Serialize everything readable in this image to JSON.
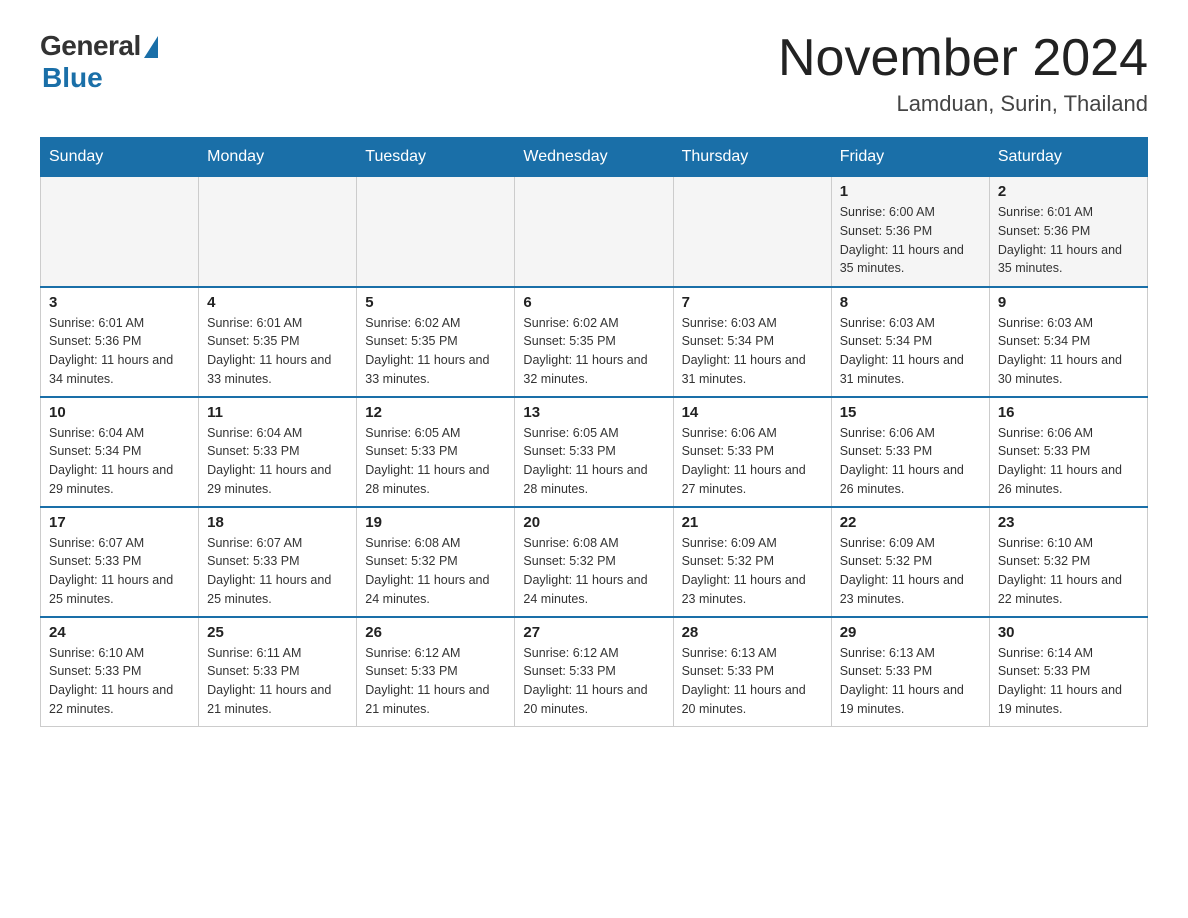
{
  "header": {
    "logo_general": "General",
    "logo_blue": "Blue",
    "month_title": "November 2024",
    "location": "Lamduan, Surin, Thailand"
  },
  "calendar": {
    "days_of_week": [
      "Sunday",
      "Monday",
      "Tuesday",
      "Wednesday",
      "Thursday",
      "Friday",
      "Saturday"
    ],
    "weeks": [
      [
        {
          "day": "",
          "sunrise": "",
          "sunset": "",
          "daylight": ""
        },
        {
          "day": "",
          "sunrise": "",
          "sunset": "",
          "daylight": ""
        },
        {
          "day": "",
          "sunrise": "",
          "sunset": "",
          "daylight": ""
        },
        {
          "day": "",
          "sunrise": "",
          "sunset": "",
          "daylight": ""
        },
        {
          "day": "",
          "sunrise": "",
          "sunset": "",
          "daylight": ""
        },
        {
          "day": "1",
          "sunrise": "Sunrise: 6:00 AM",
          "sunset": "Sunset: 5:36 PM",
          "daylight": "Daylight: 11 hours and 35 minutes."
        },
        {
          "day": "2",
          "sunrise": "Sunrise: 6:01 AM",
          "sunset": "Sunset: 5:36 PM",
          "daylight": "Daylight: 11 hours and 35 minutes."
        }
      ],
      [
        {
          "day": "3",
          "sunrise": "Sunrise: 6:01 AM",
          "sunset": "Sunset: 5:36 PM",
          "daylight": "Daylight: 11 hours and 34 minutes."
        },
        {
          "day": "4",
          "sunrise": "Sunrise: 6:01 AM",
          "sunset": "Sunset: 5:35 PM",
          "daylight": "Daylight: 11 hours and 33 minutes."
        },
        {
          "day": "5",
          "sunrise": "Sunrise: 6:02 AM",
          "sunset": "Sunset: 5:35 PM",
          "daylight": "Daylight: 11 hours and 33 minutes."
        },
        {
          "day": "6",
          "sunrise": "Sunrise: 6:02 AM",
          "sunset": "Sunset: 5:35 PM",
          "daylight": "Daylight: 11 hours and 32 minutes."
        },
        {
          "day": "7",
          "sunrise": "Sunrise: 6:03 AM",
          "sunset": "Sunset: 5:34 PM",
          "daylight": "Daylight: 11 hours and 31 minutes."
        },
        {
          "day": "8",
          "sunrise": "Sunrise: 6:03 AM",
          "sunset": "Sunset: 5:34 PM",
          "daylight": "Daylight: 11 hours and 31 minutes."
        },
        {
          "day": "9",
          "sunrise": "Sunrise: 6:03 AM",
          "sunset": "Sunset: 5:34 PM",
          "daylight": "Daylight: 11 hours and 30 minutes."
        }
      ],
      [
        {
          "day": "10",
          "sunrise": "Sunrise: 6:04 AM",
          "sunset": "Sunset: 5:34 PM",
          "daylight": "Daylight: 11 hours and 29 minutes."
        },
        {
          "day": "11",
          "sunrise": "Sunrise: 6:04 AM",
          "sunset": "Sunset: 5:33 PM",
          "daylight": "Daylight: 11 hours and 29 minutes."
        },
        {
          "day": "12",
          "sunrise": "Sunrise: 6:05 AM",
          "sunset": "Sunset: 5:33 PM",
          "daylight": "Daylight: 11 hours and 28 minutes."
        },
        {
          "day": "13",
          "sunrise": "Sunrise: 6:05 AM",
          "sunset": "Sunset: 5:33 PM",
          "daylight": "Daylight: 11 hours and 28 minutes."
        },
        {
          "day": "14",
          "sunrise": "Sunrise: 6:06 AM",
          "sunset": "Sunset: 5:33 PM",
          "daylight": "Daylight: 11 hours and 27 minutes."
        },
        {
          "day": "15",
          "sunrise": "Sunrise: 6:06 AM",
          "sunset": "Sunset: 5:33 PM",
          "daylight": "Daylight: 11 hours and 26 minutes."
        },
        {
          "day": "16",
          "sunrise": "Sunrise: 6:06 AM",
          "sunset": "Sunset: 5:33 PM",
          "daylight": "Daylight: 11 hours and 26 minutes."
        }
      ],
      [
        {
          "day": "17",
          "sunrise": "Sunrise: 6:07 AM",
          "sunset": "Sunset: 5:33 PM",
          "daylight": "Daylight: 11 hours and 25 minutes."
        },
        {
          "day": "18",
          "sunrise": "Sunrise: 6:07 AM",
          "sunset": "Sunset: 5:33 PM",
          "daylight": "Daylight: 11 hours and 25 minutes."
        },
        {
          "day": "19",
          "sunrise": "Sunrise: 6:08 AM",
          "sunset": "Sunset: 5:32 PM",
          "daylight": "Daylight: 11 hours and 24 minutes."
        },
        {
          "day": "20",
          "sunrise": "Sunrise: 6:08 AM",
          "sunset": "Sunset: 5:32 PM",
          "daylight": "Daylight: 11 hours and 24 minutes."
        },
        {
          "day": "21",
          "sunrise": "Sunrise: 6:09 AM",
          "sunset": "Sunset: 5:32 PM",
          "daylight": "Daylight: 11 hours and 23 minutes."
        },
        {
          "day": "22",
          "sunrise": "Sunrise: 6:09 AM",
          "sunset": "Sunset: 5:32 PM",
          "daylight": "Daylight: 11 hours and 23 minutes."
        },
        {
          "day": "23",
          "sunrise": "Sunrise: 6:10 AM",
          "sunset": "Sunset: 5:32 PM",
          "daylight": "Daylight: 11 hours and 22 minutes."
        }
      ],
      [
        {
          "day": "24",
          "sunrise": "Sunrise: 6:10 AM",
          "sunset": "Sunset: 5:33 PM",
          "daylight": "Daylight: 11 hours and 22 minutes."
        },
        {
          "day": "25",
          "sunrise": "Sunrise: 6:11 AM",
          "sunset": "Sunset: 5:33 PM",
          "daylight": "Daylight: 11 hours and 21 minutes."
        },
        {
          "day": "26",
          "sunrise": "Sunrise: 6:12 AM",
          "sunset": "Sunset: 5:33 PM",
          "daylight": "Daylight: 11 hours and 21 minutes."
        },
        {
          "day": "27",
          "sunrise": "Sunrise: 6:12 AM",
          "sunset": "Sunset: 5:33 PM",
          "daylight": "Daylight: 11 hours and 20 minutes."
        },
        {
          "day": "28",
          "sunrise": "Sunrise: 6:13 AM",
          "sunset": "Sunset: 5:33 PM",
          "daylight": "Daylight: 11 hours and 20 minutes."
        },
        {
          "day": "29",
          "sunrise": "Sunrise: 6:13 AM",
          "sunset": "Sunset: 5:33 PM",
          "daylight": "Daylight: 11 hours and 19 minutes."
        },
        {
          "day": "30",
          "sunrise": "Sunrise: 6:14 AM",
          "sunset": "Sunset: 5:33 PM",
          "daylight": "Daylight: 11 hours and 19 minutes."
        }
      ]
    ]
  }
}
